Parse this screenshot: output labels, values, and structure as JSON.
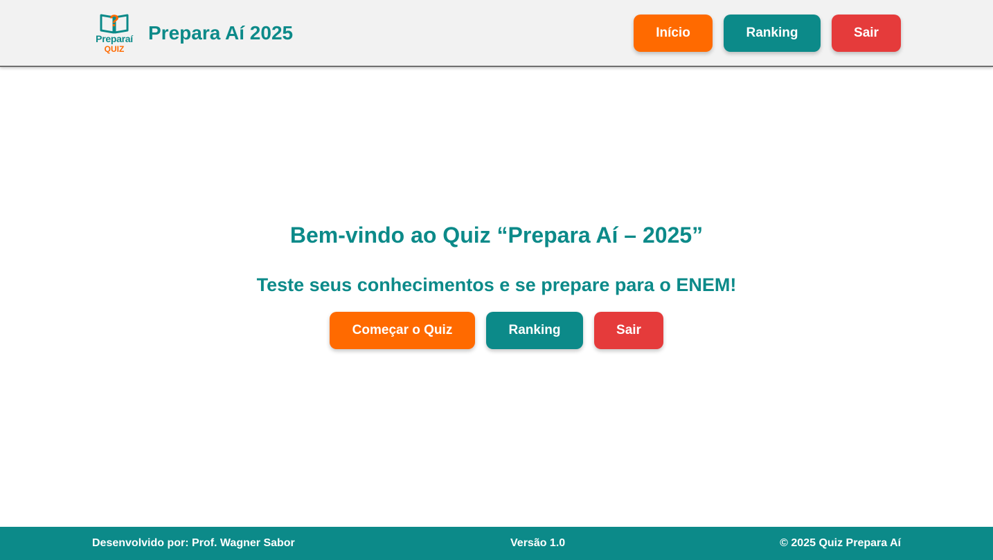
{
  "header": {
    "logo": {
      "word": "Preparaí",
      "quiz": "QUIZ",
      "mark": "?"
    },
    "title": "Prepara Aí 2025",
    "nav": {
      "home": "Início",
      "ranking": "Ranking",
      "exit": "Sair"
    }
  },
  "hero": {
    "title": "Bem-vindo ao Quiz “Prepara Aí – 2025”",
    "subtitle": "Teste seus conhecimentos e se prepare para o ENEM!",
    "start": "Começar o Quiz",
    "ranking": "Ranking",
    "exit": "Sair"
  },
  "footer": {
    "credit": "Desenvolvido por: Prof. Wagner Sabor",
    "version": "Versão 1.0",
    "copyright": "© 2025 Quiz Prepara Aí"
  },
  "colors": {
    "teal": "#0c8a89",
    "orange": "#ff6a00",
    "red": "#e53b3b",
    "header_bg": "#f2f2f2"
  }
}
